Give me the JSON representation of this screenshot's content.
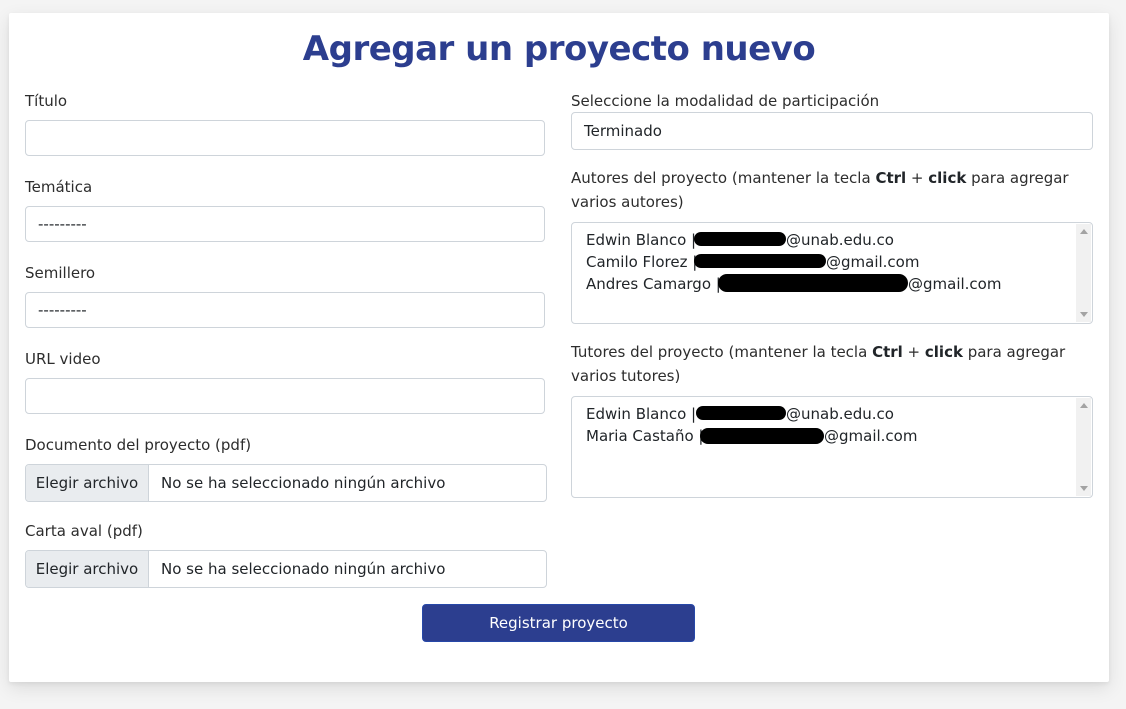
{
  "page": {
    "title": "Agregar un proyecto nuevo"
  },
  "colors": {
    "brand": "#2c3e8f",
    "redaction": "#000000"
  },
  "form": {
    "titulo_label": "Título",
    "titulo_value": "",
    "tematica_label": "Temática",
    "tematica_value": "---------",
    "semillero_label": "Semillero",
    "semillero_value": "---------",
    "url_label": "URL video",
    "url_value": "",
    "documento_label": "Documento del proyecto (pdf)",
    "documento_button": "Elegir archivo",
    "documento_status": "No se ha seleccionado ningún archivo",
    "carta_label": "Carta aval (pdf)",
    "carta_button": "Elegir archivo",
    "carta_status": "No se ha seleccionado ningún archivo",
    "modalidad_label": "Seleccione la modalidad de participación",
    "modalidad_value": "Terminado",
    "autores_label_pre": "Autores del proyecto (mantener la tecla ",
    "autores_key1": "Ctrl",
    "autores_plus": " + ",
    "autores_key2": "click",
    "autores_label_post": " para agregar varios autores)",
    "autores": [
      {
        "name": "Edwin Blanco |",
        "email_suffix": "@unab.edu.co"
      },
      {
        "name": "Camilo Florez |",
        "email_suffix": "@gmail.com"
      },
      {
        "name": "Andres Camargo |",
        "email_suffix": "@gmail.com"
      }
    ],
    "tutores_label_pre": "Tutores del proyecto (mantener la tecla ",
    "tutores_key1": "Ctrl",
    "tutores_plus": " + ",
    "tutores_key2": "click",
    "tutores_label_post": " para agregar varios tutores)",
    "tutores": [
      {
        "name": "Edwin Blanco |",
        "email_suffix": "@unab.edu.co"
      },
      {
        "name": "Maria Castaño |",
        "email_suffix": "@gmail.com"
      }
    ],
    "submit_label": "Registrar proyecto"
  }
}
